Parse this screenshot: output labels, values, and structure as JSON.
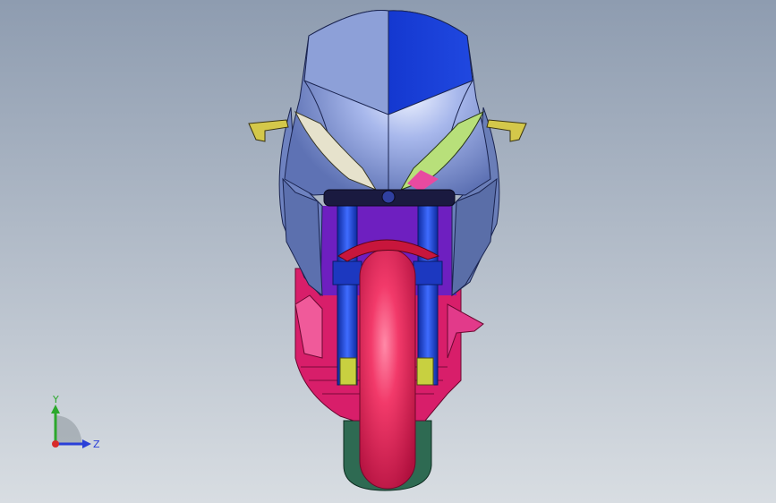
{
  "viewport": {
    "background_top": "#8e9cb0",
    "background_bottom": "#d8dde2"
  },
  "model": {
    "colors": {
      "fairing": "#7a8fcc",
      "fairing_light": "#c8d4f2",
      "fairing_accent": "#1a3ecf",
      "headlight_left": "#e6e2cc",
      "headlight_right": "#b8e07a",
      "mirror": "#d4c84a",
      "fork": "#1e3fd0",
      "tire": "#e0245a",
      "frame": "#e0206e",
      "undertray": "#2e6a52",
      "spoiler": "#c8163c"
    }
  },
  "triad": {
    "x_label": "Z",
    "y_label": "Y",
    "colors": {
      "y_axis": "#2ca82c",
      "z_axis": "#2a3fd8",
      "x_axis": "#d82a2a"
    }
  }
}
